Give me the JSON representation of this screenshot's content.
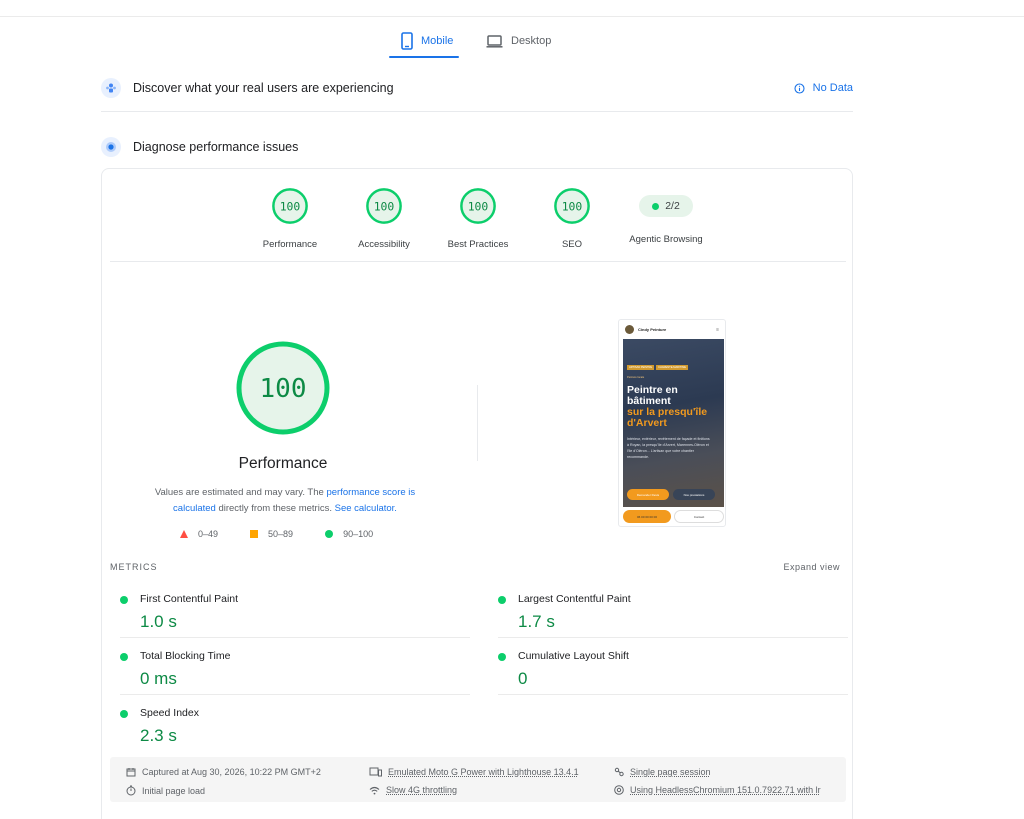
{
  "tabs": {
    "mobile": "Mobile",
    "desktop": "Desktop"
  },
  "field_data": {
    "title": "Discover what your real users are experiencing",
    "status": "No Data"
  },
  "diagnose": {
    "title": "Diagnose performance issues"
  },
  "categories": [
    {
      "label": "Performance",
      "score": "100"
    },
    {
      "label": "Accessibility",
      "score": "100"
    },
    {
      "label": "Best Practices",
      "score": "100"
    },
    {
      "label": "SEO",
      "score": "100"
    },
    {
      "label": "Agentic Browsing",
      "score": "2/2"
    }
  ],
  "performance": {
    "score": "100",
    "title": "Performance",
    "note_1": "Values are estimated and may vary. The ",
    "note_link_1": "performance score is calculated",
    "note_2": " directly from these metrics. ",
    "note_link_2": "See calculator."
  },
  "legend": {
    "fail": "0–49",
    "average": "50–89",
    "pass": "90–100"
  },
  "screenshot": {
    "brand": "Cindy Peinture",
    "tag_1": "ARTISAN PEINTRE",
    "tag_2": "CHARENTE-MARITIME",
    "sub": "Peinture locale",
    "headline_1": "Peintre en bâtiment",
    "headline_2": "sur la presqu'île d'Arvert",
    "body": "Intérieur, extérieur, revêtement de façade et finitions à Royan, la presqu'île d'Arvert, Marennes-Oléron et l'Ile d'Oléron... L'artisan que votre chantier recommande.",
    "cta_1": "Demander Devis",
    "cta_2": "Nos prestations",
    "foot_1": "06 00 00 00 00",
    "foot_2": "Contact"
  },
  "metrics_section": {
    "label": "METRICS",
    "expand": "Expand view"
  },
  "metrics": [
    {
      "name": "First Contentful Paint",
      "value": "1.0 s"
    },
    {
      "name": "Largest Contentful Paint",
      "value": "1.7 s"
    },
    {
      "name": "Total Blocking Time",
      "value": "0 ms"
    },
    {
      "name": "Cumulative Layout Shift",
      "value": "0"
    },
    {
      "name": "Speed Index",
      "value": "2.3 s"
    }
  ],
  "run_info": {
    "captured": "Captured at Aug 30, 2026, 10:22 PM GMT+2",
    "load": "Initial page load",
    "device": "Emulated Moto G Power with Lighthouse 13.4.1",
    "throttling": "Slow 4G throttling",
    "session": "Single page session",
    "browser": "Using HeadlessChromium 151.0.7922.71 with lr"
  },
  "colors": {
    "pass": "#0cce6b",
    "pass_text": "#0d8a45",
    "average": "#ffa400",
    "fail": "#ff4e42",
    "accent": "#1a73e8"
  }
}
